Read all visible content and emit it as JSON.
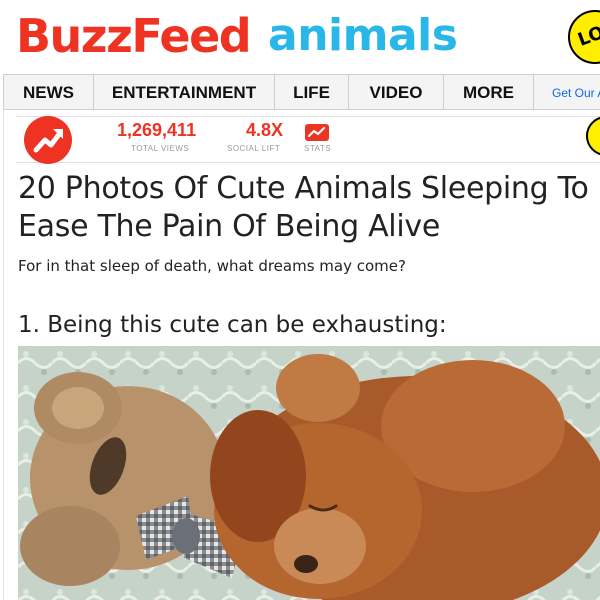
{
  "header": {
    "logo_primary": "BuzzFeed",
    "logo_section": "animals",
    "badge_text": "LO",
    "brand_red": "#ee3322",
    "brand_blue": "#29b6e8"
  },
  "nav": {
    "items": [
      {
        "label": "NEWS"
      },
      {
        "label": "ENTERTAINMENT"
      },
      {
        "label": "LIFE"
      },
      {
        "label": "VIDEO"
      },
      {
        "label": "MORE"
      }
    ],
    "get_our": "Get Our A"
  },
  "stats": {
    "trending_icon": "trending-arrow-icon",
    "total_views": "1,269,411",
    "total_views_label": "TOTAL VIEWS",
    "social_lift": "4.8X",
    "social_lift_label": "SOCIAL LIFT",
    "stats_label": "STATS",
    "stats_icon": "line-chart-icon"
  },
  "article": {
    "title": "20 Photos Of Cute Animals Sleeping To Ease The Pain Of Being Alive",
    "subtitle": "For in that sleep of death, what dreams may come?",
    "items": [
      {
        "heading": "1. Being this cute can be exhausting:"
      }
    ]
  }
}
